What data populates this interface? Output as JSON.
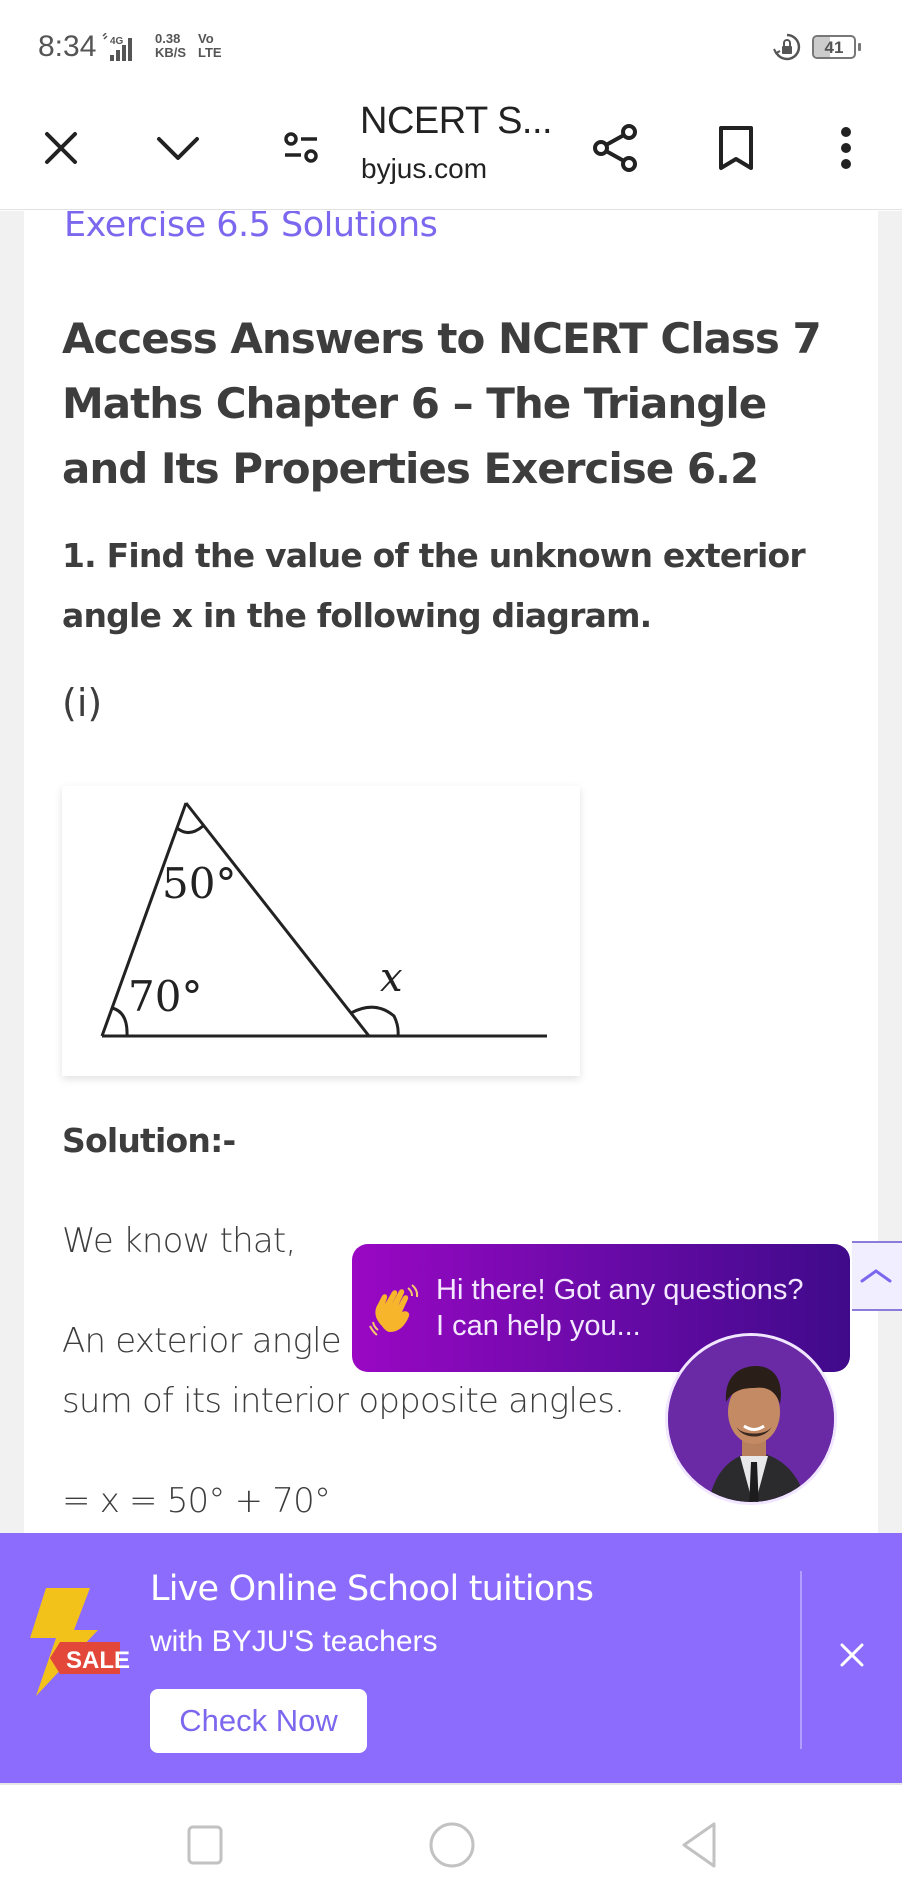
{
  "status_bar": {
    "time": "8:34",
    "network": "4G",
    "speed_value": "0.38",
    "speed_unit": "KB/S",
    "volte_top": "Vo",
    "volte_bottom": "LTE",
    "battery_level": "41",
    "battery_fraction": 0.41
  },
  "toolbar": {
    "title": "NCERT S...",
    "domain": "byjus.com",
    "icons": [
      "close-icon",
      "chevron-down-icon",
      "site-settings-icon",
      "share-icon",
      "bookmark-icon",
      "more-vert-icon"
    ]
  },
  "article": {
    "prev_link": "Exercise 6.5 Solutions",
    "heading": "Access Answers to NCERT Class 7 Maths Chapter 6 – The Triangle and Its Properties Exercise 6.2",
    "question": "1. Find the value of the unknown exterior angle x in the following diagram.",
    "sub_label": "(i)",
    "figure": {
      "top_angle": "50°",
      "bottom_left_angle": "70°",
      "exterior_angle": "x"
    },
    "solution_label": "Solution:-",
    "line1": "We know that,",
    "line2": "An exterior angle",
    "line3": "sum of its interior opposite angles.",
    "line4": "= x = 50° + 70°"
  },
  "chat": {
    "line1": "Hi there! Got any questions?",
    "line2": "I can help you..."
  },
  "promo": {
    "badge": "SALE",
    "title": "Live Online School tuitions",
    "subtitle": "with BYJU'S teachers",
    "button": "Check Now"
  },
  "colors": {
    "accent": "#7b68ee",
    "promo_bg": "#8b6cfc",
    "chat_start": "#9a08c4",
    "chat_end": "#3f0a8a"
  }
}
